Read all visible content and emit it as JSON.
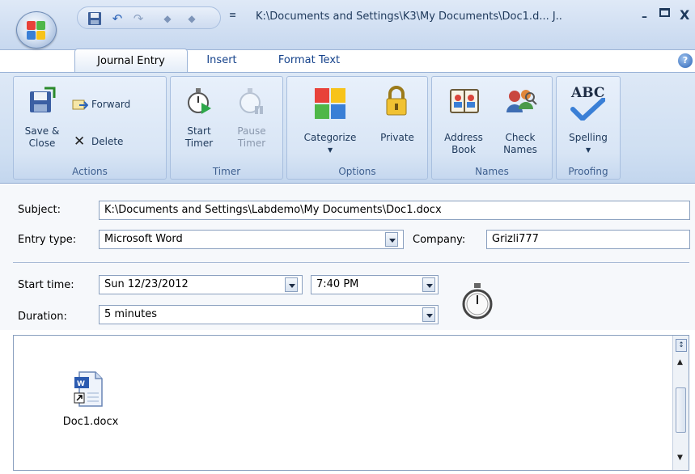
{
  "window": {
    "title": "K:\\Documents and Settings\\K3\\My Documents\\Doc1.d... J..",
    "minimize": "–",
    "close": "X"
  },
  "qat": {
    "customize": "≡"
  },
  "tabs": [
    {
      "label": "Journal Entry",
      "active": true
    },
    {
      "label": "Insert",
      "active": false
    },
    {
      "label": "Format Text",
      "active": false
    }
  ],
  "ribbon": {
    "groups": {
      "actions": {
        "label": "Actions",
        "save_close": "Save &\nClose",
        "forward": "Forward",
        "delete": "Delete"
      },
      "timer": {
        "label": "Timer",
        "start": "Start\nTimer",
        "pause": "Pause\nTimer"
      },
      "options": {
        "label": "Options",
        "categorize": "Categorize",
        "private": "Private"
      },
      "names": {
        "label": "Names",
        "address_book": "Address\nBook",
        "check_names": "Check\nNames"
      },
      "proofing": {
        "label": "Proofing",
        "spelling": "Spelling",
        "spelling_icon_text": "ABC"
      }
    }
  },
  "form": {
    "subject": {
      "label": "Subject:",
      "value": "K:\\Documents and Settings\\Labdemo\\My Documents\\Doc1.docx"
    },
    "entry_type": {
      "label": "Entry type:",
      "value": "Microsoft Word"
    },
    "company": {
      "label": "Company:",
      "value": "Grizli777"
    },
    "start_time": {
      "label": "Start time:",
      "date": "Sun 12/23/2012",
      "time": "7:40 PM"
    },
    "duration": {
      "label": "Duration:",
      "value": "5 minutes"
    }
  },
  "body": {
    "attachment": "Doc1.docx"
  },
  "colors": {
    "ribbon_bg": "#d8e5f5",
    "tab_text": "#15428b",
    "category_red": "#e8423a",
    "category_yellow": "#f7c31a",
    "category_green": "#4fb748",
    "category_blue": "#3a7fd6"
  }
}
